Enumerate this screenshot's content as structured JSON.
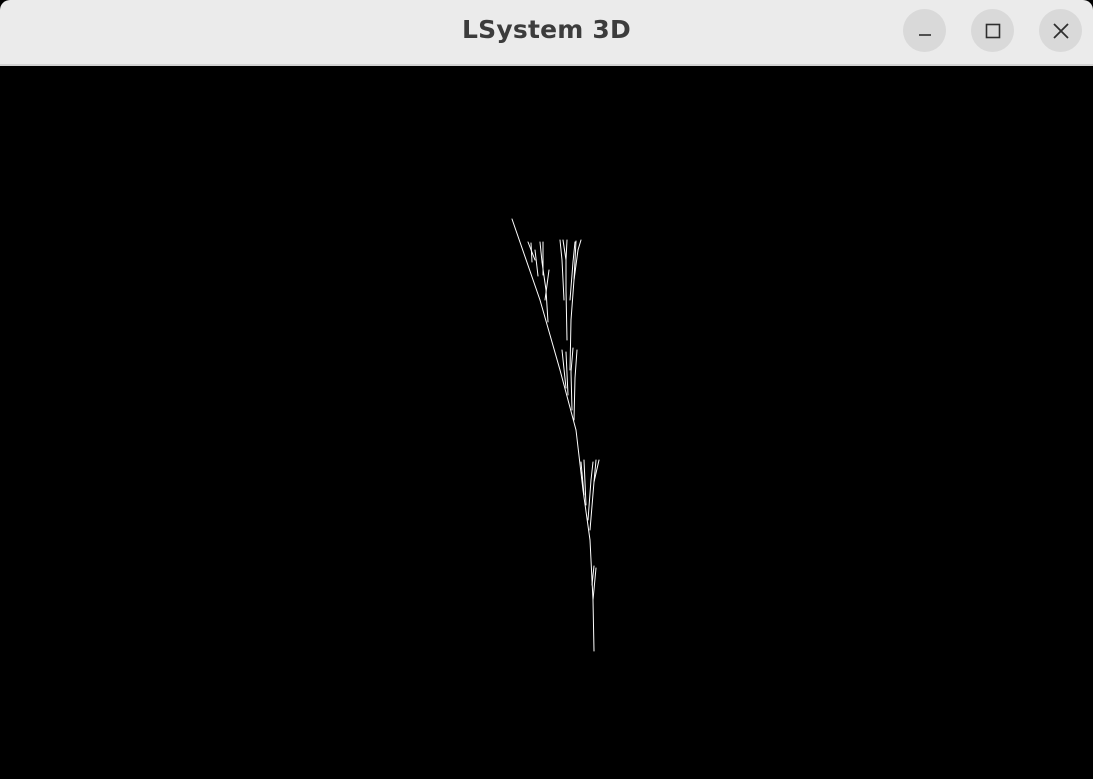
{
  "window": {
    "title": "LSystem 3D"
  },
  "controls": {
    "minimize_icon": "minimize-icon",
    "maximize_icon": "maximize-icon",
    "close_icon": "close-icon"
  },
  "viewport": {
    "background": "#000000",
    "line_color": "#ffffff",
    "content": "l-system-tree"
  },
  "colors": {
    "titlebar_bg": "#ebebeb",
    "title_text": "#3c3c3c",
    "button_bg": "#d9d9d9",
    "icon": "#2e2e2e"
  }
}
